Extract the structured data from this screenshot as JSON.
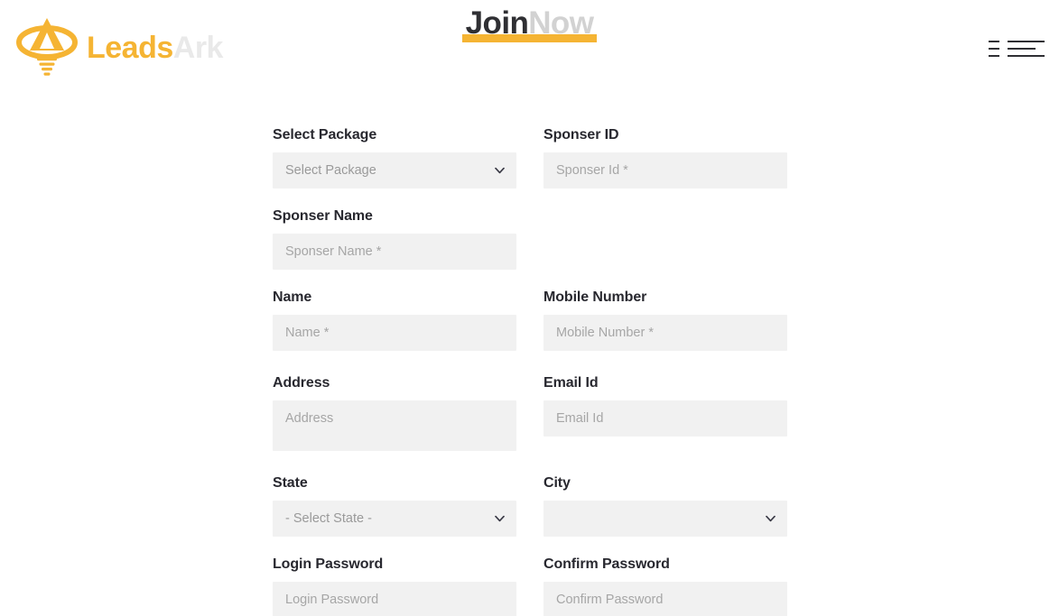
{
  "brand": {
    "logo_icon": "leadsark-flame-funnel-logo",
    "name_primary": "Leads",
    "name_secondary": "Ark",
    "color_primary": "#f5b433",
    "color_secondary": "#e9e9e9"
  },
  "header": {
    "title_primary": "Join",
    "title_secondary": "Now",
    "title_primary_color": "#2f2f33",
    "title_secondary_color": "#d2d2d2",
    "underline_color": "#f5b433",
    "menu_icon": "hamburger-menu-icon"
  },
  "form": {
    "field_bg": "#f1f1f1",
    "label_color": "#28282f",
    "placeholder_color": "#a6a6a6",
    "chevron_icon": "chevron-down-icon",
    "rows": [
      {
        "left": {
          "label": "Select Package",
          "type": "select",
          "value": "Select Package",
          "name": "select-package"
        },
        "right": {
          "label": "Sponser ID",
          "type": "text",
          "placeholder": "Sponser Id *",
          "value": "",
          "name": "sponser-id"
        }
      },
      {
        "left": {
          "label": "Sponser Name",
          "type": "text",
          "placeholder": "Sponser Name *",
          "value": "",
          "name": "sponser-name"
        },
        "right": null
      },
      {
        "left": {
          "label": "Name",
          "type": "text",
          "placeholder": "Name *",
          "value": "",
          "name": "name"
        },
        "right": {
          "label": "Mobile Number",
          "type": "text",
          "placeholder": "Mobile Number *",
          "value": "",
          "name": "mobile-number"
        }
      },
      {
        "left": {
          "label": "Address",
          "type": "textarea",
          "placeholder": "Address",
          "value": "",
          "name": "address"
        },
        "right": {
          "label": "Email Id",
          "type": "text",
          "placeholder": "Email Id",
          "value": "",
          "name": "email-id"
        }
      },
      {
        "left": {
          "label": "State",
          "type": "select",
          "value": "- Select State -",
          "name": "state"
        },
        "right": {
          "label": "City",
          "type": "select",
          "value": "",
          "name": "city"
        }
      },
      {
        "left": {
          "label": "Login Password",
          "type": "text",
          "placeholder": "Login Password",
          "value": "",
          "name": "login-password"
        },
        "right": {
          "label": "Confirm Password",
          "type": "text",
          "placeholder": "Confirm Password",
          "value": "",
          "name": "confirm-password"
        }
      }
    ]
  }
}
